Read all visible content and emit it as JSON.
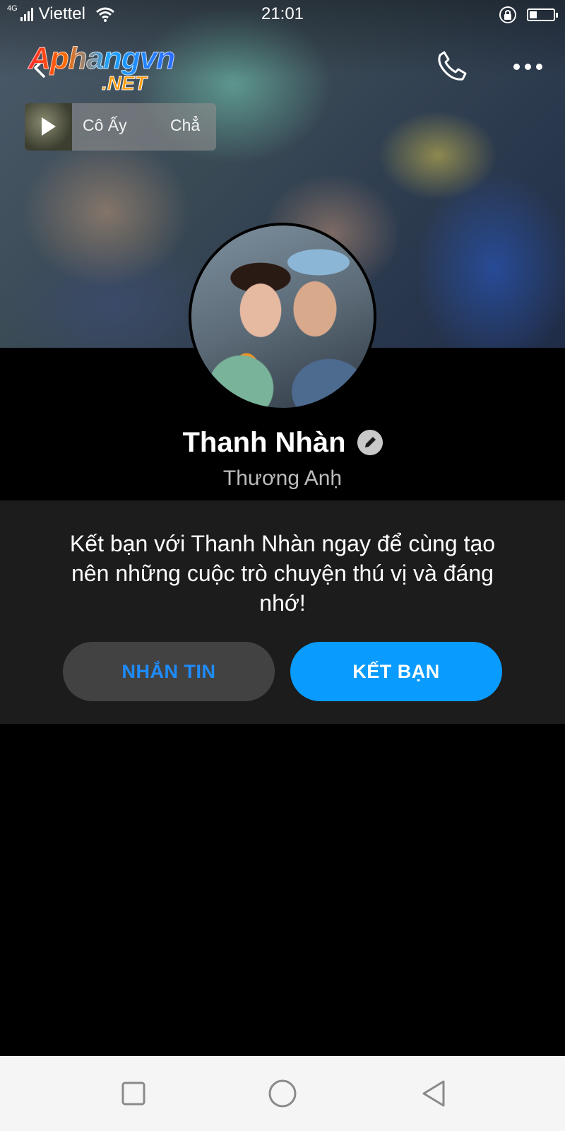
{
  "status_bar": {
    "network": "4G",
    "carrier": "Viettel",
    "time": "21:01",
    "battery_level": 0.3
  },
  "header": {
    "logo_main": "Aphangvn",
    "logo_sub": ".NET",
    "icons": {
      "back": "back-arrow-icon",
      "phone": "phone-icon",
      "more": "more-dots-icon"
    }
  },
  "music": {
    "title": "Cô Ấy",
    "title_2": "Chẳ",
    "icon": "play-icon"
  },
  "profile": {
    "name": "Thanh Nhàn",
    "nickname": "Thương Anḥ"
  },
  "friend_prompt": {
    "message": "Kết bạn với Thanh Nhàn ngay để cùng tạo nên những cuộc trò chuyện thú vị và đáng nhớ!",
    "message_button": "NHẮN TIN",
    "add_friend_button": "KẾT BẠN"
  },
  "colors": {
    "accent": "#0a9bff",
    "message_button_text": "#1e8cff",
    "card_bg": "#1c1c1c",
    "page_bg": "#000000"
  },
  "nav_bar": {
    "icons": [
      "recent-apps-icon",
      "home-icon",
      "back-icon"
    ]
  }
}
